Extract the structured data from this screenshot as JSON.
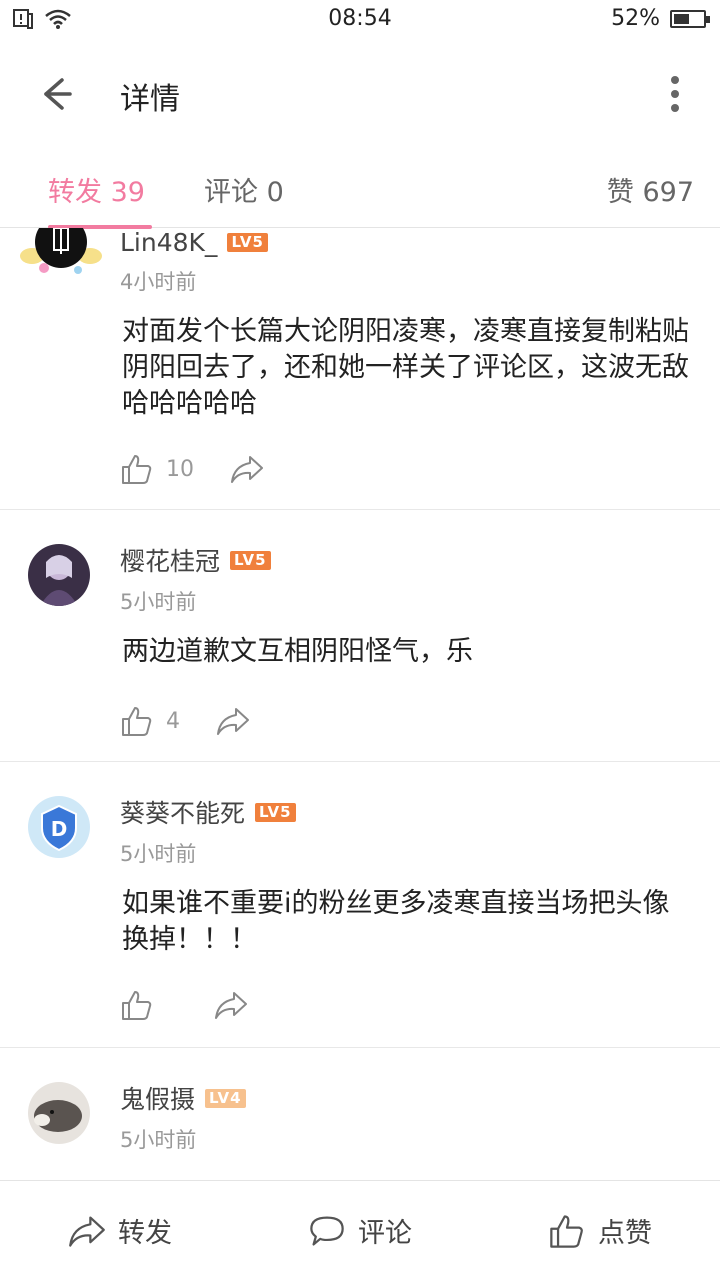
{
  "status_bar": {
    "time": "08:54",
    "battery": "52%",
    "battery_level": 0.52
  },
  "header": {
    "title": "详情"
  },
  "tabs": {
    "repost": "转发 39",
    "comment": "评论 0",
    "likes": "赞 697"
  },
  "items": [
    {
      "username": "Lin48K_",
      "level": "LV5",
      "time": "4小时前",
      "text": "对面发个长篇大论阴阳凌寒，凌寒直接复制粘贴阴阳回去了，还和她一样关了评论区，这波无敌哈哈哈哈哈",
      "likes": "10"
    },
    {
      "username": "樱花桂冠",
      "level": "LV5",
      "time": "5小时前",
      "text": "两边道歉文互相阴阳怪气，乐",
      "likes": "4"
    },
    {
      "username": "葵葵不能死",
      "level": "LV5",
      "time": "5小时前",
      "text": "如果谁不重要i的粉丝更多凌寒直接当场把头像换掉！！！",
      "likes": ""
    },
    {
      "username": "鬼假摄",
      "level": "LV4",
      "time": "5小时前",
      "text": "",
      "likes": ""
    }
  ],
  "bottom_bar": {
    "repost": "转发",
    "comment": "评论",
    "like": "点赞"
  },
  "colors": {
    "accent": "#f27ba0",
    "level_badge": "#f0803c",
    "level_badge_light": "#f7c18e"
  }
}
